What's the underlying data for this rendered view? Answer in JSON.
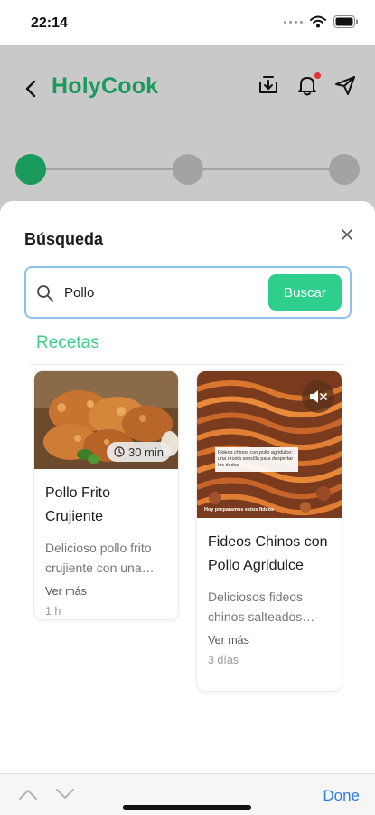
{
  "status_bar": {
    "time": "22:14"
  },
  "header": {
    "app_name": "HolyCook"
  },
  "stepper": {
    "steps": 3,
    "active_step": 1
  },
  "modal": {
    "title": "Búsqueda",
    "search": {
      "value": "Pollo",
      "button_label": "Buscar"
    },
    "section_title": "Recetas"
  },
  "recipes": [
    {
      "duration": "30 min",
      "title": "Pollo Frito Crujiente",
      "description": "Delicioso pollo frito crujiente con una…",
      "more": "Ver más",
      "time_ago": "1 h"
    },
    {
      "overlay_note": "Fideos chinos con pollo agridulce: una receta sencilla para despertar los dedos",
      "overlay_caption": "Hoy preparamos estos fideos",
      "title": "Fideos Chinos con Pollo Agridulce",
      "description": "Deliciosos fideos chinos salteados…",
      "more": "Ver más",
      "time_ago": "3 días"
    }
  ],
  "bottom_bar": {
    "done_label": "Done"
  },
  "colors": {
    "brand_green": "#1a9b5c",
    "accent_green": "#2ecf8d",
    "search_border": "#8ec1ec",
    "notification": "#e0333a",
    "link_blue": "#2f7be6"
  },
  "icons": [
    "back-arrow-icon",
    "download-icon",
    "bell-icon",
    "send-icon",
    "close-icon",
    "search-icon",
    "clock-icon",
    "mute-icon",
    "chevron-up-icon",
    "chevron-down-icon",
    "wifi-icon",
    "battery-icon",
    "signal-icon"
  ]
}
